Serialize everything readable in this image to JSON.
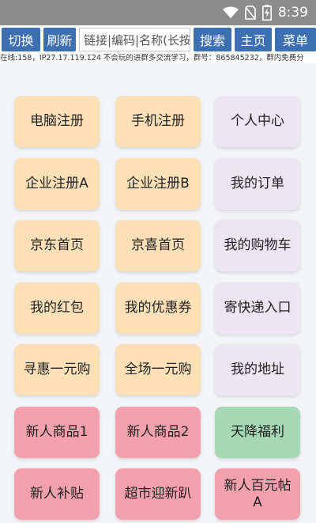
{
  "status_bar": {
    "time": "8:39",
    "wifi_icon": "wifi-icon",
    "no_sim_icon": "no-sim-icon",
    "battery_icon": "battery-charging-icon"
  },
  "toolbar": {
    "switch_label": "切换",
    "refresh_label": "刷新",
    "search_placeholder": "链接|编码|名称(长按",
    "search_label": "搜索",
    "home_label": "主页",
    "menu_label": "菜单"
  },
  "ticker": {
    "text": "在线:158，IP27.17.119.124 不会玩的进群多交流学习，群号：865845232，群内免费分"
  },
  "colors": {
    "orange": "#fde0b8",
    "lavender": "#ece5f4",
    "pink": "#f3a2ad",
    "green": "#a6d8b4",
    "button": "#3d6fb3"
  },
  "tiles": [
    {
      "label": "电脑注册",
      "color": "orange"
    },
    {
      "label": "手机注册",
      "color": "orange"
    },
    {
      "label": "个人中心",
      "color": "lavender"
    },
    {
      "label": "企业注册A",
      "color": "orange"
    },
    {
      "label": "企业注册B",
      "color": "orange"
    },
    {
      "label": "我的订单",
      "color": "lavender"
    },
    {
      "label": "京东首页",
      "color": "orange"
    },
    {
      "label": "京喜首页",
      "color": "orange"
    },
    {
      "label": "我的购物车",
      "color": "lavender"
    },
    {
      "label": "我的红包",
      "color": "orange"
    },
    {
      "label": "我的优惠券",
      "color": "orange"
    },
    {
      "label": "寄快递入口",
      "color": "lavender"
    },
    {
      "label": "寻惠一元购",
      "color": "orange"
    },
    {
      "label": "全场一元购",
      "color": "orange"
    },
    {
      "label": "我的地址",
      "color": "lavender"
    },
    {
      "label": "新人商品1",
      "color": "pink"
    },
    {
      "label": "新人商品2",
      "color": "pink"
    },
    {
      "label": "天降福利",
      "color": "green"
    },
    {
      "label": "新人补贴",
      "color": "pink"
    },
    {
      "label": "超市迎新趴",
      "color": "pink"
    },
    {
      "label": "新人百元帖A",
      "color": "pink"
    }
  ]
}
